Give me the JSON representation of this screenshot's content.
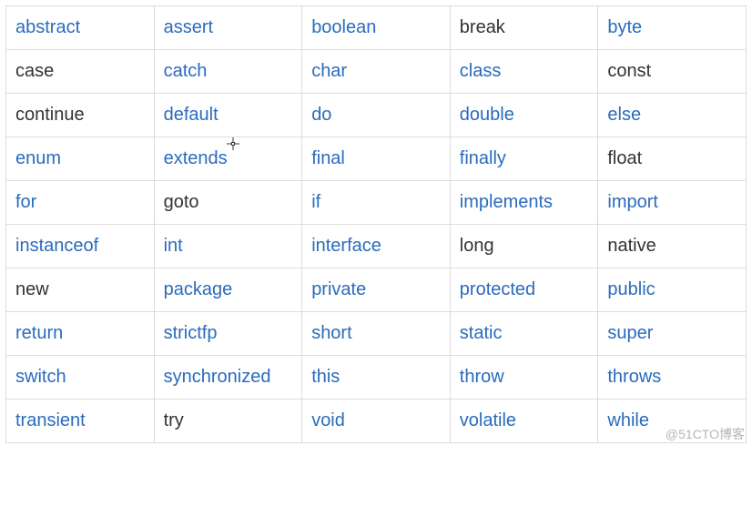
{
  "keywords": [
    [
      {
        "text": "abstract",
        "link": true
      },
      {
        "text": "assert",
        "link": true
      },
      {
        "text": "boolean",
        "link": true
      },
      {
        "text": "break",
        "link": false
      },
      {
        "text": "byte",
        "link": true
      }
    ],
    [
      {
        "text": "case",
        "link": false
      },
      {
        "text": "catch",
        "link": true
      },
      {
        "text": "char",
        "link": true
      },
      {
        "text": "class",
        "link": true
      },
      {
        "text": "const",
        "link": false
      }
    ],
    [
      {
        "text": "continue",
        "link": false
      },
      {
        "text": "default",
        "link": true
      },
      {
        "text": "do",
        "link": true
      },
      {
        "text": "double",
        "link": true
      },
      {
        "text": "else",
        "link": true
      }
    ],
    [
      {
        "text": "enum",
        "link": true
      },
      {
        "text": "extends",
        "link": true
      },
      {
        "text": "final",
        "link": true
      },
      {
        "text": "finally",
        "link": true
      },
      {
        "text": "float",
        "link": false
      }
    ],
    [
      {
        "text": "for",
        "link": true
      },
      {
        "text": "goto",
        "link": false
      },
      {
        "text": "if",
        "link": true
      },
      {
        "text": "implements",
        "link": true
      },
      {
        "text": "import",
        "link": true
      }
    ],
    [
      {
        "text": "instanceof",
        "link": true
      },
      {
        "text": "int",
        "link": true
      },
      {
        "text": "interface",
        "link": true
      },
      {
        "text": "long",
        "link": false
      },
      {
        "text": "native",
        "link": false
      }
    ],
    [
      {
        "text": "new",
        "link": false
      },
      {
        "text": "package",
        "link": true
      },
      {
        "text": "private",
        "link": true
      },
      {
        "text": "protected",
        "link": true
      },
      {
        "text": "public",
        "link": true
      }
    ],
    [
      {
        "text": "return",
        "link": true
      },
      {
        "text": "strictfp",
        "link": true
      },
      {
        "text": "short",
        "link": true
      },
      {
        "text": "static",
        "link": true
      },
      {
        "text": "super",
        "link": true
      }
    ],
    [
      {
        "text": "switch",
        "link": true
      },
      {
        "text": "synchronized",
        "link": true
      },
      {
        "text": "this",
        "link": true
      },
      {
        "text": "throw",
        "link": true
      },
      {
        "text": "throws",
        "link": true
      }
    ],
    [
      {
        "text": "transient",
        "link": true
      },
      {
        "text": "try",
        "link": false
      },
      {
        "text": "void",
        "link": true
      },
      {
        "text": "volatile",
        "link": true
      },
      {
        "text": "while",
        "link": true
      }
    ]
  ],
  "watermark": "@51CTO博客"
}
